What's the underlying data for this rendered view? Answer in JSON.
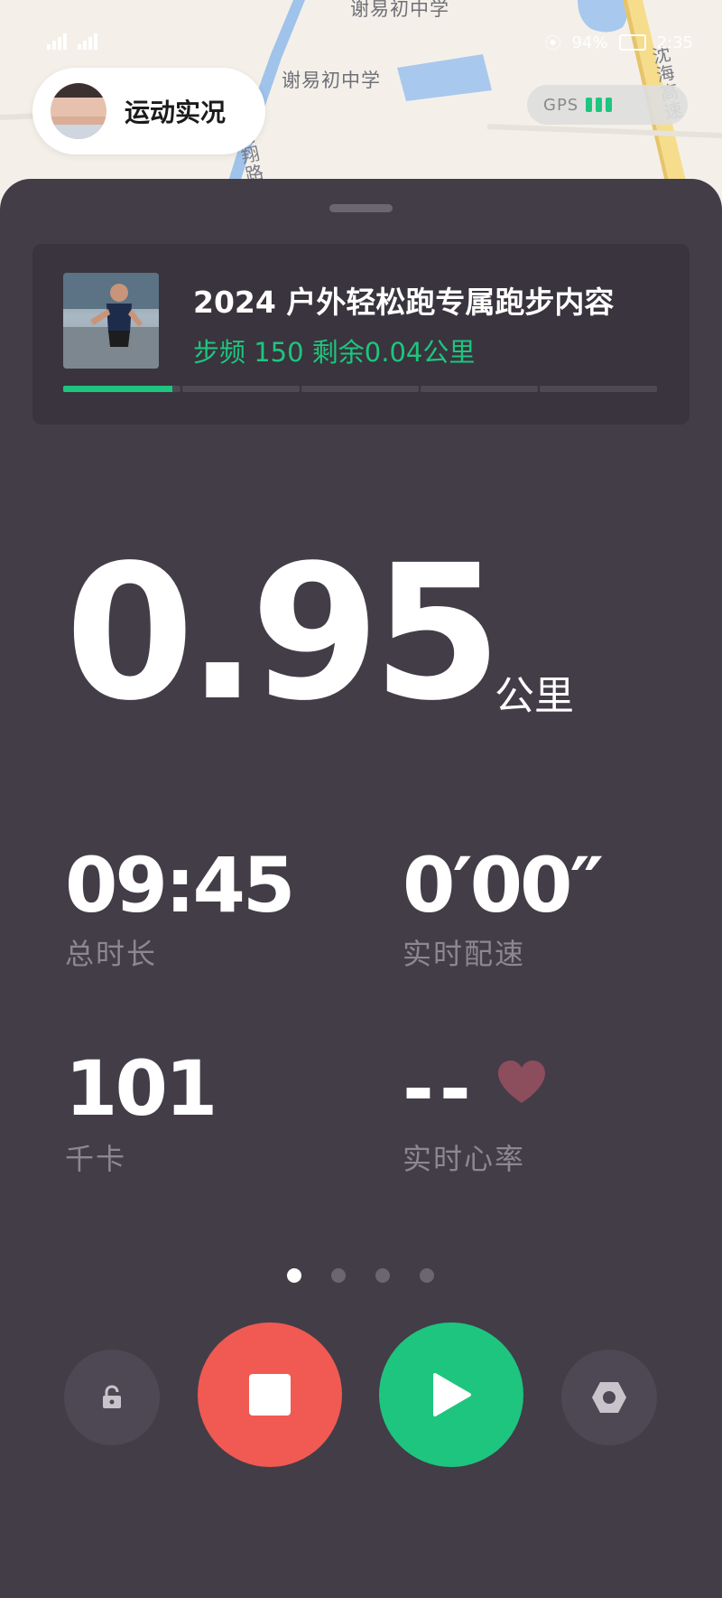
{
  "map": {
    "labels": {
      "school_top": "谢易初中学",
      "school": "谢易初中学",
      "road_south": "南翔路",
      "highway": "沈海高速"
    }
  },
  "statusbar": {
    "battery": "94%",
    "time": "2:35"
  },
  "header": {
    "live_label": "运动实况",
    "gps_label": "GPS"
  },
  "course": {
    "title": "2024 户外轻松跑专属跑步内容",
    "subtitle": "步频 150 剩余0.04公里",
    "progress_segments": 5,
    "progress_fraction_first_segment": 0.93
  },
  "distance": {
    "value": "0.95",
    "unit": "公里"
  },
  "stats": {
    "duration": {
      "value": "09:45",
      "label": "总时长"
    },
    "pace": {
      "value": "0′00″",
      "label": "实时配速"
    },
    "calories": {
      "value": "101",
      "label": "千卡"
    },
    "heart_rate": {
      "value": "--",
      "label": "实时心率"
    }
  },
  "pager": {
    "count": 4,
    "active_index": 0
  },
  "controls": {
    "lock_icon": "unlock-icon",
    "stop_icon": "stop-icon",
    "play_icon": "play-icon",
    "settings_icon": "settings-hexagon-icon"
  },
  "colors": {
    "accent_green": "#1ec57e",
    "stop_red": "#f05a52",
    "panel_bg": "#433d48",
    "heart_color": "#8c4d5d"
  }
}
